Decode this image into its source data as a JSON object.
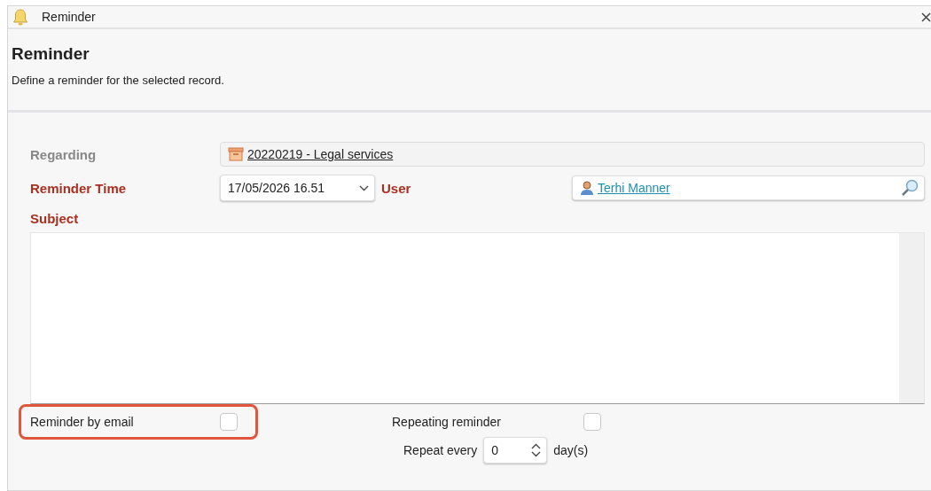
{
  "window": {
    "title": "Reminder"
  },
  "header": {
    "title": "Reminder",
    "description": "Define a reminder for the selected record."
  },
  "form": {
    "regarding": {
      "label": "Regarding",
      "value": "20220219 - Legal services",
      "required": false
    },
    "reminder_time": {
      "label": "Reminder Time",
      "value": "17/05/2026 16.51",
      "required": true
    },
    "user": {
      "label": "User",
      "value": "Terhi Manner",
      "required": true
    },
    "subject": {
      "label": "Subject",
      "required": true
    }
  },
  "options": [
    {
      "label": "Reminder by email",
      "checked": false,
      "highlighted": true
    },
    {
      "label": "Repeating reminder",
      "checked": false,
      "highlighted": false
    }
  ],
  "repeat": {
    "label": "Repeat every",
    "value": "0",
    "unit": "day(s)"
  }
}
